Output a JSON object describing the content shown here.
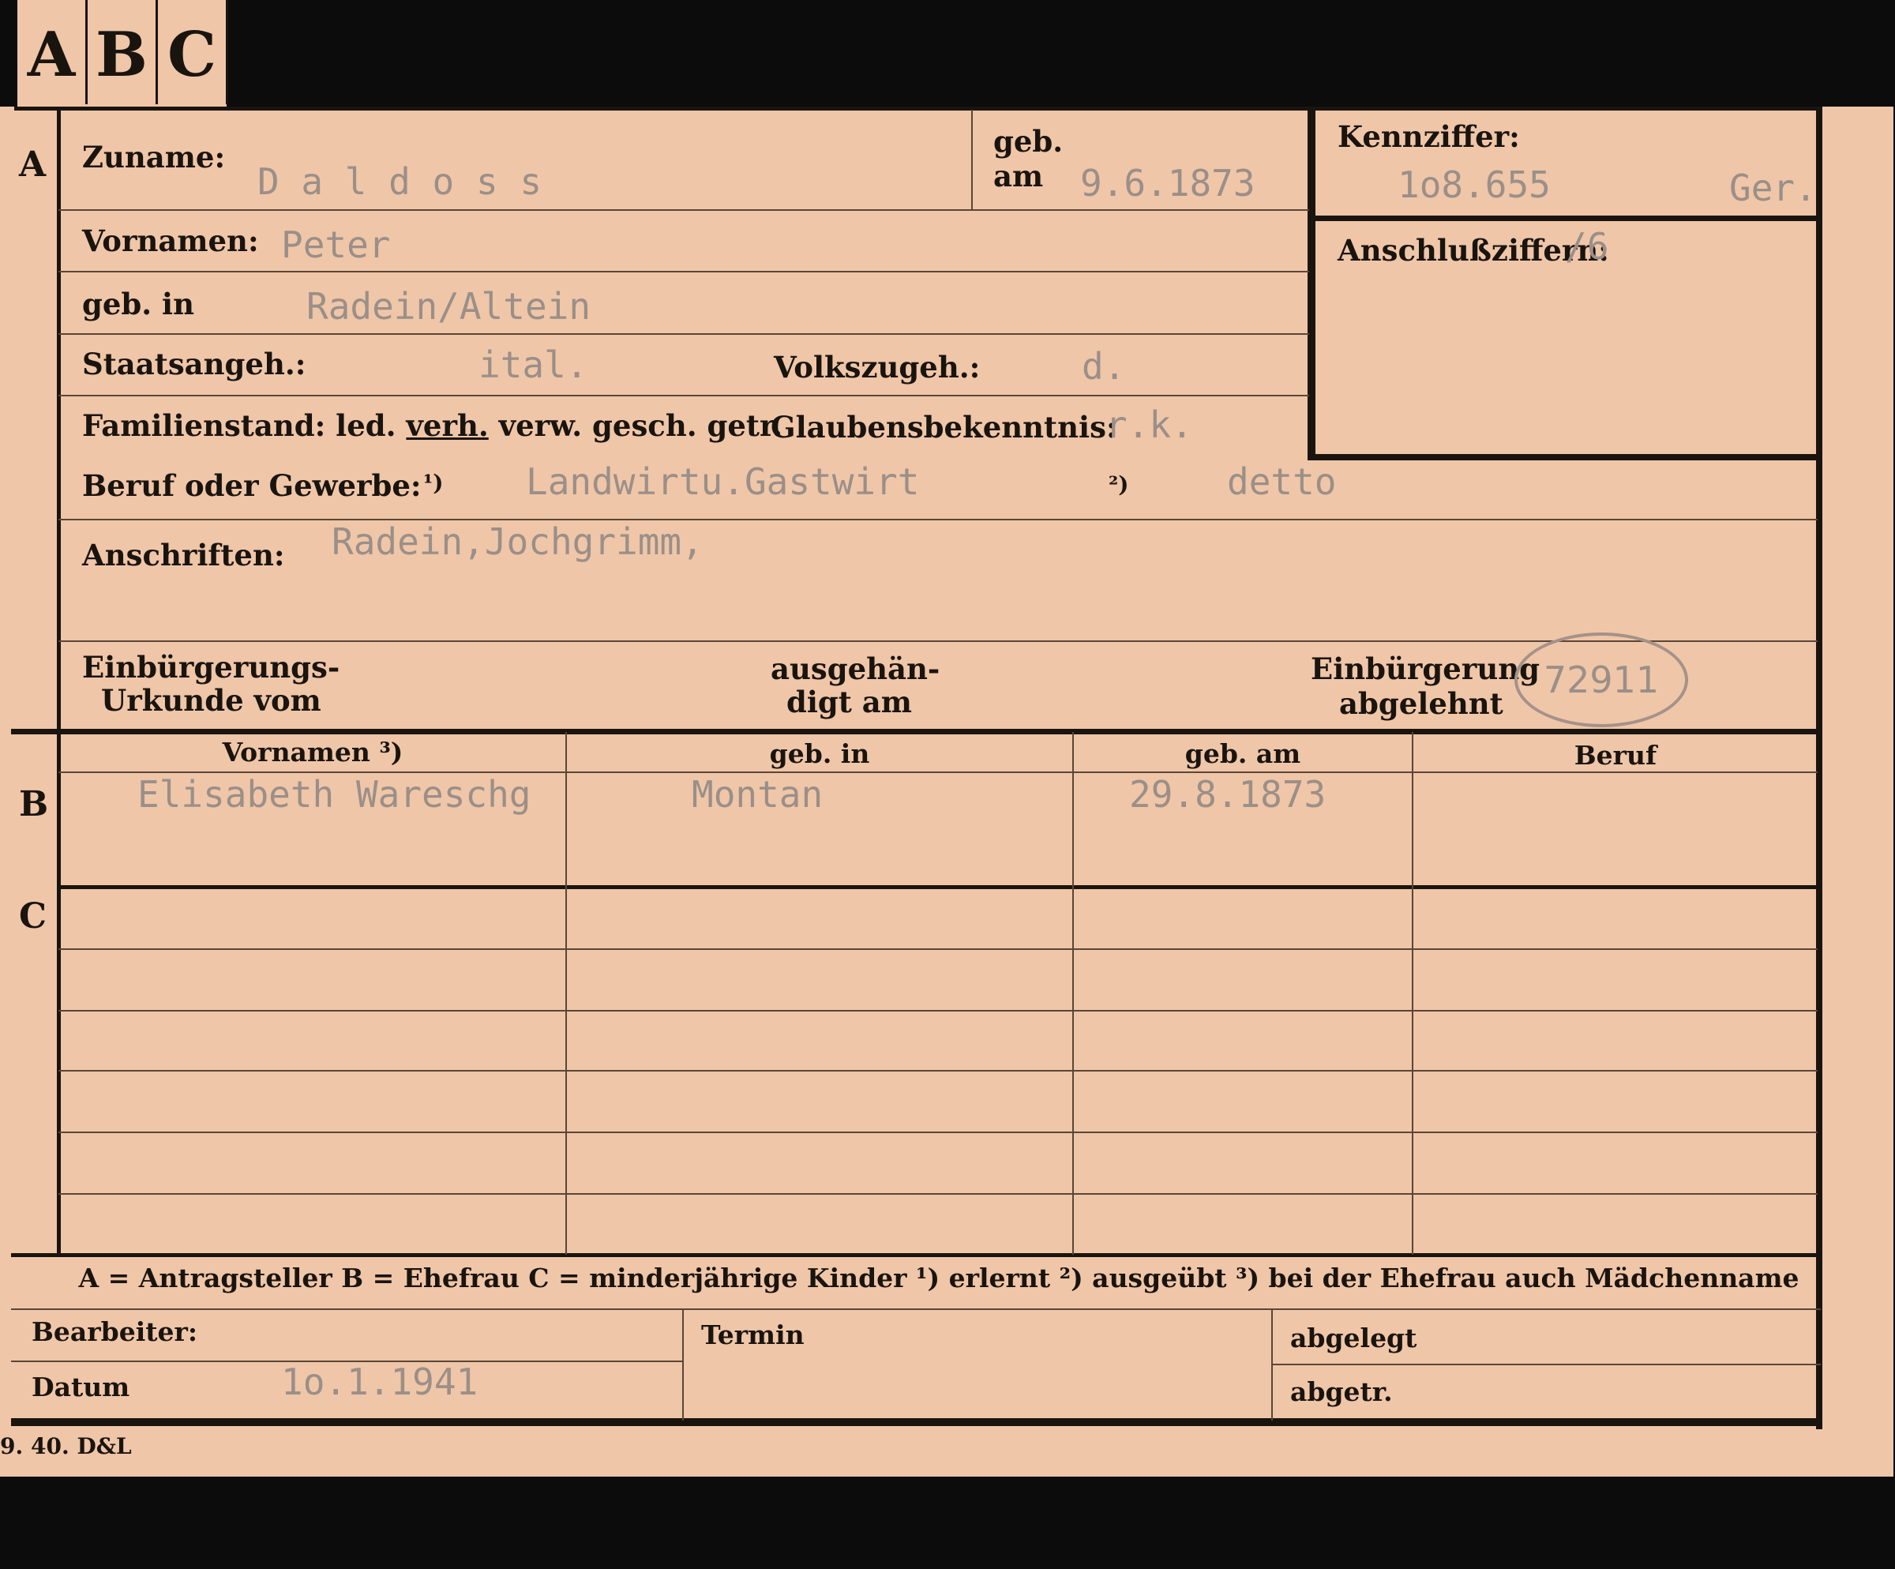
{
  "tabs": [
    "A",
    "B",
    "C"
  ],
  "section_letters": {
    "a": "A",
    "b": "B",
    "c": "C"
  },
  "labels": {
    "zuname": "Zuname:",
    "geb_am_1": "geb.",
    "geb_am_2": "am",
    "kennziffer": "Kennziffer:",
    "vornamen": "Vornamen:",
    "anschlussziffern": "Anschlußziffern:",
    "geb_in": "geb. in",
    "staatsangeh": "Staatsangeh.:",
    "volkszugeh": "Volkszugeh.:",
    "familienstand_prefix": "Familienstand: led. ",
    "familienstand_underlined": "verh.",
    "familienstand_suffix": " verw. gesch. getr.",
    "glaubensbekenntnis": "Glaubensbekenntnis:",
    "beruf": "Beruf oder Gewerbe:",
    "fn1": "¹)",
    "fn2": "²)",
    "anschriften": "Anschriften:",
    "einbuergerungs_1": "Einbürgerungs-",
    "einbuergerungs_2": "Urkunde vom",
    "ausgehaen_1": "ausgehän-",
    "ausgehaen_2": "digt am",
    "einbuergerung_1": "Einbürgerung",
    "einbuergerung_2": "abgelehnt"
  },
  "applicant": {
    "zuname": "D a l d o s s",
    "geb_am": "9.6.1873",
    "kennziffer": "1o8.655",
    "kennziffer_suffix": "Ger.",
    "vornamen": "Peter",
    "anschlussziffern": "/6",
    "geb_in": "Radein/Altein",
    "staatsangeh": "ital.",
    "volkszugeh": "d.",
    "glaubensbekenntnis": "r.k.",
    "beruf1": "Landwirtu.Gastwirt",
    "beruf2": "detto",
    "anschriften": "Radein,Jochgrimm,",
    "stamp": "72911"
  },
  "family_table": {
    "headers": [
      "Vornamen ³)",
      "geb. in",
      "geb. am",
      "Beruf"
    ],
    "wife": [
      "Elisabeth Wareschg",
      "Montan",
      "29.8.1873",
      ""
    ]
  },
  "legend": "A = Antragsteller   B = Ehefrau   C = minderjährige Kinder   ¹) erlernt   ²) ausgeübt   ³) bei der Ehefrau auch Mädchenname",
  "footer": {
    "bearbeiter": "Bearbeiter:",
    "datum": "Datum",
    "datum_value": "1o.1.1941",
    "termin": "Termin",
    "abgelegt": "abgelegt",
    "abgetr": "abgetr."
  },
  "print_code": "9. 40. D&L"
}
